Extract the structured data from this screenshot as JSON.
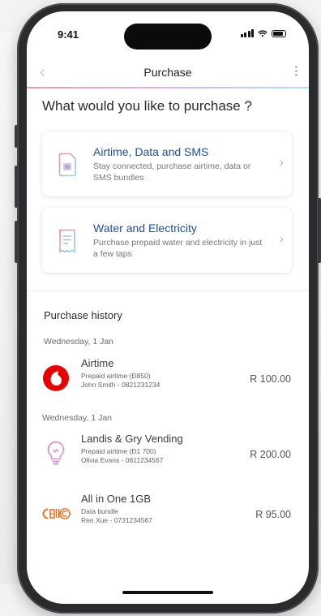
{
  "status_bar": {
    "time": "9:41"
  },
  "nav": {
    "title": "Purchase"
  },
  "heading": "What would you like to purchase ?",
  "options": [
    {
      "title": "Airtime, Data and SMS",
      "description": "Stay connected, purchase airtime, data or SMS bundles",
      "icon": "sim-card-icon"
    },
    {
      "title": "Water and Electricity",
      "description": "Purchase prepaid water and electricity in just a few taps",
      "icon": "receipt-icon"
    }
  ],
  "history": {
    "title": "Purchase history",
    "groups": [
      {
        "date": "Wednesday, 1 Jan"
      },
      {
        "date": "Wednesday, 1 Jan"
      }
    ],
    "items": [
      {
        "name": "Airtime",
        "line1": "Prepaid airtime (Ð850)",
        "line2": "John Smith - 0821231234",
        "amount": "R 100.00",
        "icon": "vodacom-logo-icon"
      },
      {
        "name": "Landis & Gry Vending",
        "line1": "Prepaid airtime (Ð1 700)",
        "line2": "Olivia Evans - 0811234567",
        "amount": "R 200.00",
        "icon": "lightbulb-icon"
      },
      {
        "name": "All in One 1GB",
        "line1": "Data bundle",
        "line2": "Ren Xue - 0731234567",
        "amount": "R 95.00",
        "icon": "cellc-logo-icon"
      }
    ]
  },
  "colors": {
    "accent": "#1f4e96",
    "brand_red": "#e60000",
    "cellc_orange": "#e8742a"
  }
}
